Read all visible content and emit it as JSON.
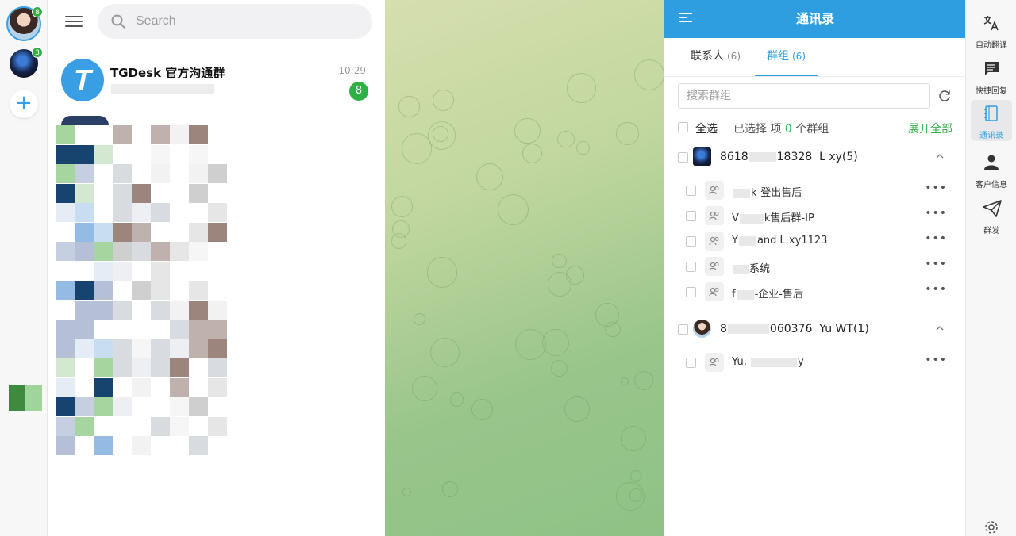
{
  "accounts": [
    {
      "badge": "8"
    },
    {
      "badge": "3"
    }
  ],
  "chatlist": {
    "search_placeholder": "Search",
    "chats": [
      {
        "avatar_letter": "T",
        "name": "TGDesk 官方沟通群",
        "time": "10:29",
        "unread": "8"
      }
    ]
  },
  "contacts_panel": {
    "title": "通讯录",
    "tabs": [
      {
        "label": "联系人",
        "count": "(6)"
      },
      {
        "label": "群组",
        "count": "(6)"
      }
    ],
    "search_placeholder": "搜索群组",
    "select_all": "全选",
    "selected_prefix": "已选择 项",
    "selected_count": "0",
    "selected_suffix": "个群组",
    "expand_all": "展开全部",
    "accounts": [
      {
        "id_start": "8618",
        "id_end": "18328",
        "name": "L xy(5)",
        "groups": [
          {
            "prefix": "",
            "suffix": "k-登出售后"
          },
          {
            "prefix": "V",
            "suffix": "k售后群-IP"
          },
          {
            "prefix": "Y",
            "suffix": "and L xy1123"
          },
          {
            "prefix": "",
            "suffix": "系统"
          },
          {
            "prefix": "f",
            "suffix": "-企业-售后"
          }
        ]
      },
      {
        "id_start": "8",
        "id_end": "060376",
        "name": "Yu WT(1)",
        "groups": [
          {
            "prefix": "Yu, ",
            "suffix": "y"
          }
        ]
      }
    ],
    "more_label": "•••"
  },
  "tools": [
    {
      "icon": "translate-icon",
      "label": "自动翻译"
    },
    {
      "icon": "quick-reply-icon",
      "label": "快捷回复"
    },
    {
      "icon": "contacts-book-icon",
      "label": "通讯录"
    },
    {
      "icon": "customer-info-icon",
      "label": "客户信息"
    },
    {
      "icon": "broadcast-icon",
      "label": "群发"
    }
  ],
  "colors": {
    "accent": "#2f9ee0",
    "unread": "#2fb045",
    "header": "#2f9ee0"
  }
}
